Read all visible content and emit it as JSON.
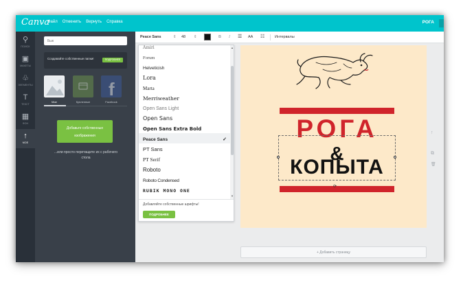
{
  "app": {
    "logo": "Canva",
    "menu": [
      "Файл",
      "Отменить",
      "Вернуть",
      "Справка"
    ],
    "document_title": "РОГА"
  },
  "rail": [
    {
      "label": "ПОИСК",
      "icon": "search-icon",
      "glyph": "⚲"
    },
    {
      "label": "МАКЕТЫ",
      "icon": "layouts-icon",
      "glyph": "▣"
    },
    {
      "label": "ЭЛЕМЕНТЫ",
      "icon": "elements-icon",
      "glyph": "♧"
    },
    {
      "label": "ТЕКСТ",
      "icon": "text-icon",
      "glyph": "T"
    },
    {
      "label": "ФОН",
      "icon": "background-icon",
      "glyph": "▦"
    },
    {
      "label": "МОЕ",
      "icon": "upload-icon",
      "glyph": "↑"
    }
  ],
  "panel": {
    "search_value": "Бык",
    "folders_text": "Создавайте собственные папки!",
    "folders_button": "ПОДРОБНЕЕ",
    "sources": [
      {
        "label": "Мое"
      },
      {
        "label": "Купленные"
      },
      {
        "label": "Facebook"
      }
    ],
    "upload_button": "Добавьте собственные изображения",
    "drag_text": "...или просто перетащите их с рабочего стола"
  },
  "toolbar": {
    "font": "Peace Sans",
    "size": "48",
    "caret": "⇕",
    "bold": "B",
    "italic": "I",
    "align": "☰",
    "case": "AA",
    "list": "☷",
    "intervals": "Интервалы",
    "text_color": "#111111"
  },
  "dropdown": {
    "fonts": [
      {
        "name": "Amiri",
        "style": "font-family:'DejaVu Serif',serif;font-size:6px;color:#666"
      },
      {
        "name": "Forum",
        "style": "font-family:'Liberation Serif',serif;font-size:6.5px;color:#444"
      },
      {
        "name": "Helveticish",
        "style": "font-size:6.5px"
      },
      {
        "name": "Lora",
        "style": "font-family:'DejaVu Serif',serif;font-size:8px"
      },
      {
        "name": "Marta",
        "style": "font-family:'Liberation Serif',serif;font-size:7px"
      },
      {
        "name": "Merriweather",
        "style": "font-family:'DejaVu Serif',serif;font-size:7.5px"
      },
      {
        "name": "Open Sans Light",
        "style": "font-size:7px;color:#777"
      },
      {
        "name": "Open Sans",
        "style": "font-family:'DejaVu Sans',sans-serif;font-size:8px"
      },
      {
        "name": "Open Sans Extra Bold",
        "style": "font-family:'DejaVu Sans',sans-serif;font-size:7px;font-weight:bold"
      },
      {
        "name": "Peace Sans",
        "style": "font-size:6.5px;font-weight:bold",
        "selected": true
      },
      {
        "name": "PT Sans",
        "style": "font-size:7.5px"
      },
      {
        "name": "PT Serif",
        "style": "font-family:'Liberation Serif',serif;font-size:7.5px"
      },
      {
        "name": "Roboto",
        "style": "font-size:8px"
      },
      {
        "name": "Roboto Condensed",
        "style": "font-size:6.5px;letter-spacing:-0.2px"
      },
      {
        "name": "RUBIK MONO ONE",
        "style": "font-family:'DejaVu Sans Mono',monospace;font-size:6.5px;font-weight:bold;letter-spacing:1px"
      }
    ],
    "checkmark": "✓",
    "custom_fonts_text": "Добавляйте собственные шрифты!",
    "more_button": "ПОДРОБНЕЕ"
  },
  "design": {
    "line1": "РОГА",
    "ampersand": "&",
    "line2": "КОПЫТА",
    "accent_color": "#d0242b",
    "background_color": "#fde9c9"
  },
  "canvas": {
    "add_page_label": "+ Добавить страницу",
    "side_tools": [
      {
        "icon": "move-up-icon",
        "glyph": "↑"
      },
      {
        "icon": "copy-icon",
        "glyph": "⧉"
      },
      {
        "icon": "delete-icon",
        "glyph": "🗑"
      }
    ]
  },
  "colors": {
    "brand": "#00c4cc",
    "panel": "#394049",
    "rail": "#293039",
    "cta": "#7ac142"
  }
}
